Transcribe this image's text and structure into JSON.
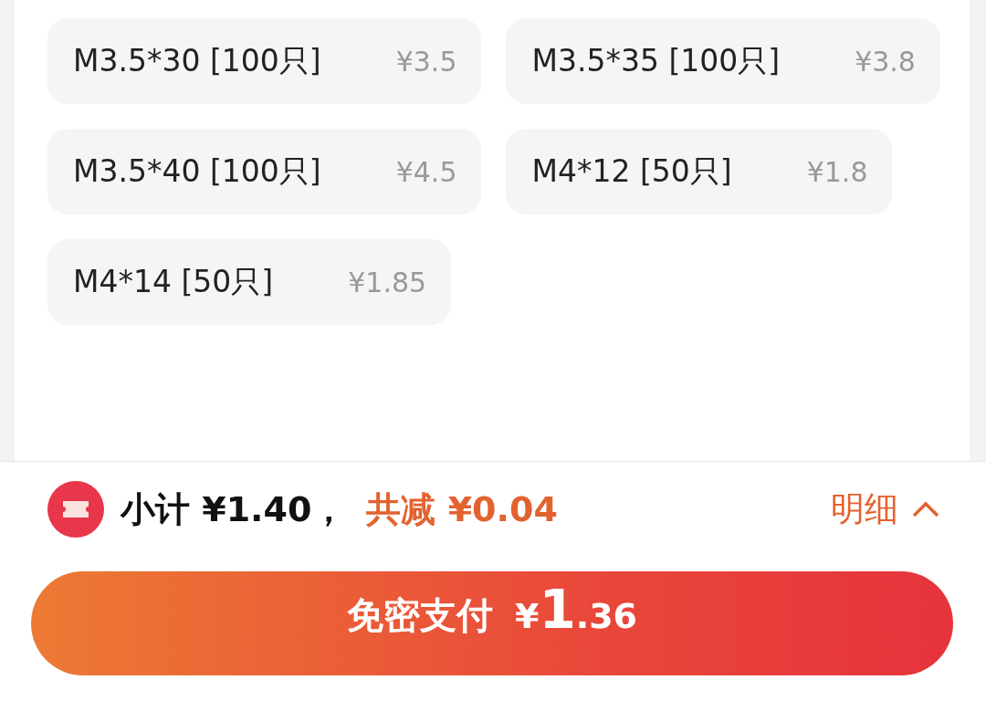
{
  "options": [
    {
      "name": "M3.5*30 [100只]",
      "price": "¥3.5"
    },
    {
      "name": "M3.5*35 [100只]",
      "price": "¥3.8"
    },
    {
      "name": "M3.5*40 [100只]",
      "price": "¥4.5"
    },
    {
      "name": "M4*12 [50只]",
      "price": "¥1.8"
    },
    {
      "name": "M4*14 [50只]",
      "price": "¥1.85"
    }
  ],
  "summary": {
    "subtotal": "小计 ¥1.40，",
    "discount": "共减 ¥0.04",
    "details_link": "明细"
  },
  "pay_button": {
    "label": "免密支付",
    "currency": "¥",
    "amount_integer": "1",
    "amount_decimal": ".36"
  }
}
